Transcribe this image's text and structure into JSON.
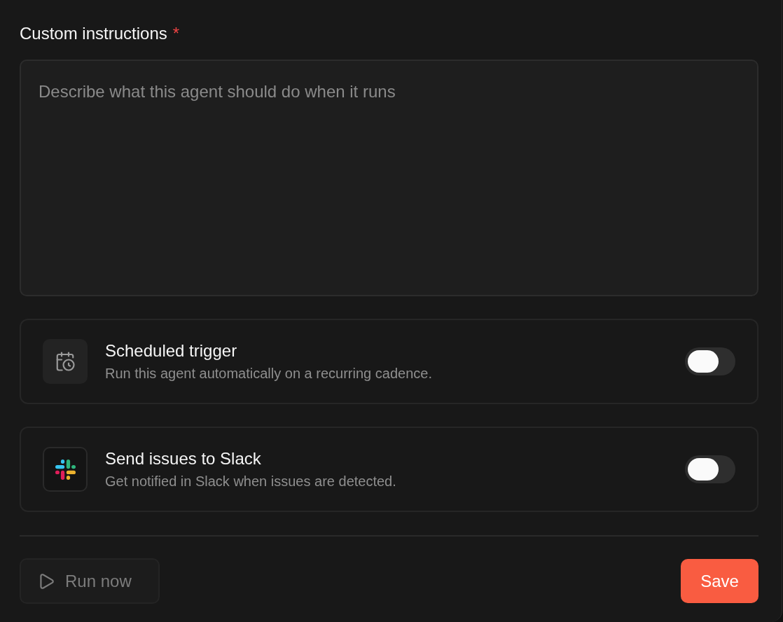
{
  "field": {
    "label": "Custom instructions",
    "required_mark": "*",
    "placeholder": "Describe what this agent should do when it runs"
  },
  "options": [
    {
      "kind": "schedule",
      "title": "Scheduled trigger",
      "description": "Run this agent automatically on a recurring cadence.",
      "on": false
    },
    {
      "kind": "slack",
      "title": "Send issues to Slack",
      "description": "Get notified in Slack when issues are detected.",
      "on": false
    }
  ],
  "actions": {
    "run": {
      "label": "Run now",
      "disabled": true
    },
    "save": {
      "label": "Save"
    }
  }
}
